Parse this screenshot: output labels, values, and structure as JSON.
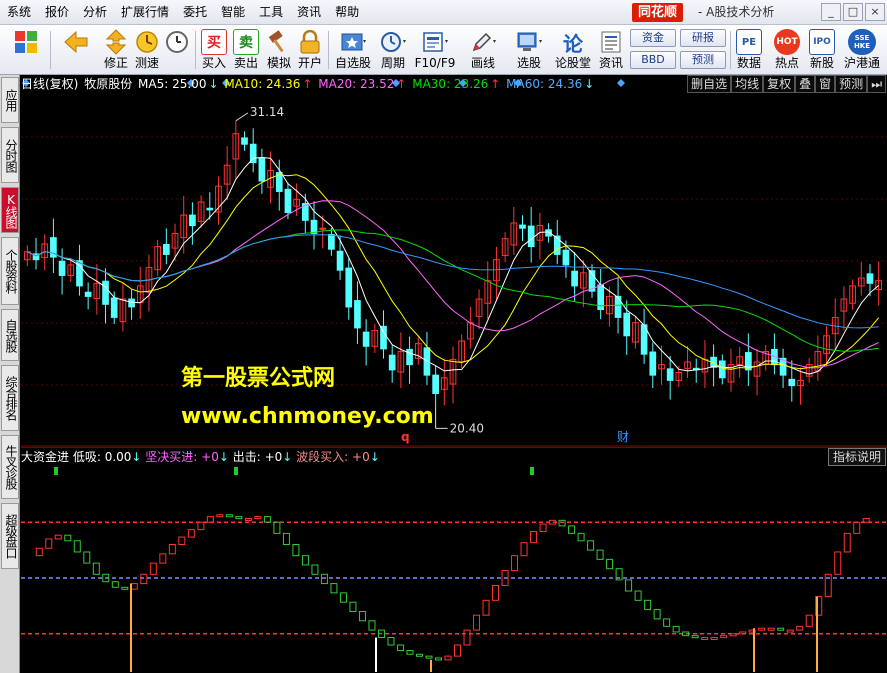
{
  "menu": {
    "items": [
      "系统",
      "报价",
      "分析",
      "扩展行情",
      "委托",
      "智能",
      "工具",
      "资讯",
      "帮助"
    ],
    "brand": "同花顺",
    "app_title": "- A股技术分析",
    "window_controls": [
      "_",
      "□",
      "×"
    ]
  },
  "toolbar": {
    "buttons": [
      {
        "label": "",
        "icon": "windows-grid-icon"
      },
      {
        "label": "",
        "icon": "back-arrow-icon"
      },
      {
        "label": "修正",
        "icon": "up-down-arrows-icon"
      },
      {
        "label": "测速",
        "icon": "speed-clock-icon"
      },
      {
        "label": "",
        "icon": "clock-icon"
      },
      {
        "label": "买入",
        "icon": "buy-icon",
        "glyph": "买"
      },
      {
        "label": "卖出",
        "icon": "sell-icon",
        "glyph": "卖"
      },
      {
        "label": "模拟",
        "icon": "hammer-icon"
      },
      {
        "label": "开户",
        "icon": "lock-icon"
      },
      {
        "label": "自选股",
        "icon": "favorites-icon"
      },
      {
        "label": "周期",
        "icon": "period-icon"
      },
      {
        "label": "F10/F9",
        "icon": "f10-icon"
      },
      {
        "label": "画线",
        "icon": "pen-icon"
      },
      {
        "label": "选股",
        "icon": "screen-icon"
      },
      {
        "label": "论股堂",
        "icon": "forum-icon",
        "glyph": "论"
      },
      {
        "label": "资讯",
        "icon": "news-icon"
      },
      {
        "label": "数据",
        "icon": "pe-data-icon",
        "glyph": "PE"
      },
      {
        "label": "热点",
        "icon": "hot-icon",
        "glyph": "HOT"
      },
      {
        "label": "新股",
        "icon": "ipo-icon",
        "glyph": "IPO"
      },
      {
        "label": "沪港通",
        "icon": "hk-connect-icon",
        "glyph": "SSE HKE"
      }
    ],
    "small_buttons": [
      "资金",
      "研报",
      "BBD",
      "预测"
    ]
  },
  "sidetabs": [
    "应用",
    "分时图",
    "K线图",
    "个股资料",
    "自选股",
    "综合排名",
    "牛叉诊股",
    "超级盘口"
  ],
  "active_tab": "K线图",
  "infobar": {
    "title": "日线(复权)",
    "stock": "牧原股份",
    "ma5": "MA5: 25.00",
    "ma10": "MA10: 24.36",
    "ma20": "MA20: 23.52",
    "ma30": "MA30: 23.26",
    "ma60": "MA60: 24.36",
    "buttons": [
      "删自选",
      "均线",
      "复权",
      "叠",
      "窗",
      "预测",
      "⏭"
    ]
  },
  "chart_data": {
    "type": "candlestick",
    "ma_lines": [
      "MA5",
      "MA10",
      "MA20",
      "MA30",
      "MA60"
    ],
    "high_label": "31.14",
    "low_label": "20.40",
    "event_marks": [
      "q",
      "财"
    ],
    "watermark": {
      "line1": "第一股票公式网",
      "line2": "www.chnmoney.com"
    },
    "close_series": [
      26.1,
      25.8,
      26.4,
      25.9,
      25.2,
      25.6,
      24.8,
      24.4,
      24.9,
      24.1,
      23.6,
      24.3,
      24.0,
      24.8,
      25.5,
      26.3,
      26.0,
      26.8,
      27.5,
      27.1,
      28.0,
      27.7,
      28.6,
      29.4,
      30.6,
      30.2,
      29.5,
      28.8,
      29.2,
      28.4,
      27.6,
      28.1,
      27.3,
      26.8,
      27.0,
      26.2,
      25.4,
      24.0,
      23.2,
      22.5,
      23.1,
      22.4,
      21.6,
      22.3,
      21.8,
      22.6,
      21.4,
      20.7,
      21.3,
      22.0,
      22.7,
      23.4,
      24.3,
      25.0,
      25.8,
      26.6,
      27.2,
      27.0,
      26.3,
      27.1,
      26.7,
      26.0,
      25.6,
      24.8,
      25.3,
      24.6,
      23.9,
      24.4,
      23.6,
      22.9,
      23.4,
      22.2,
      21.4,
      21.8,
      21.2,
      21.5,
      21.9,
      21.6,
      22.0,
      21.7,
      21.3,
      21.8,
      22.1,
      21.6,
      21.9,
      22.3,
      21.8,
      21.4,
      21.0,
      21.2,
      21.8,
      22.3,
      22.9,
      23.6,
      24.3,
      24.8,
      25.1,
      24.9,
      25.0
    ]
  },
  "indicator": {
    "name": "大资金进",
    "low_buy": "低吸: 0.00",
    "firm_buy": "坚决买进: +0",
    "exit": "出击: +0",
    "wave_buy": "波段买入: +0",
    "explain_button": "指标说明",
    "levels": [
      80,
      50,
      20
    ],
    "values": [
      62,
      66,
      71,
      73,
      70,
      64,
      58,
      52,
      48,
      45,
      44,
      47,
      52,
      58,
      63,
      68,
      72,
      76,
      80,
      83,
      84,
      83,
      82,
      82,
      83,
      80,
      74,
      68,
      62,
      57,
      52,
      47,
      42,
      37,
      32,
      27,
      22,
      18,
      14,
      11,
      9,
      8,
      7,
      6,
      8,
      14,
      22,
      30,
      38,
      46,
      54,
      62,
      69,
      75,
      79,
      81,
      78,
      74,
      70,
      65,
      60,
      55,
      49,
      43,
      38,
      33,
      28,
      24,
      21,
      19,
      18,
      18,
      18,
      19,
      20,
      21,
      22,
      23,
      23,
      22,
      22,
      24,
      30,
      40,
      52,
      64,
      74,
      80,
      82
    ]
  },
  "colors": {
    "up": "#ff3333",
    "down": "#54ffff",
    "ma5": "#ffffff",
    "ma10": "#ffff00",
    "ma20": "#ff66ff",
    "ma30": "#00e000",
    "ma60": "#3399ff",
    "level_high": "#ff3333",
    "level_mid": "#8888ff",
    "level_low": "#ff3333",
    "ind_up": "#ff3333",
    "ind_down": "#33cc33"
  }
}
